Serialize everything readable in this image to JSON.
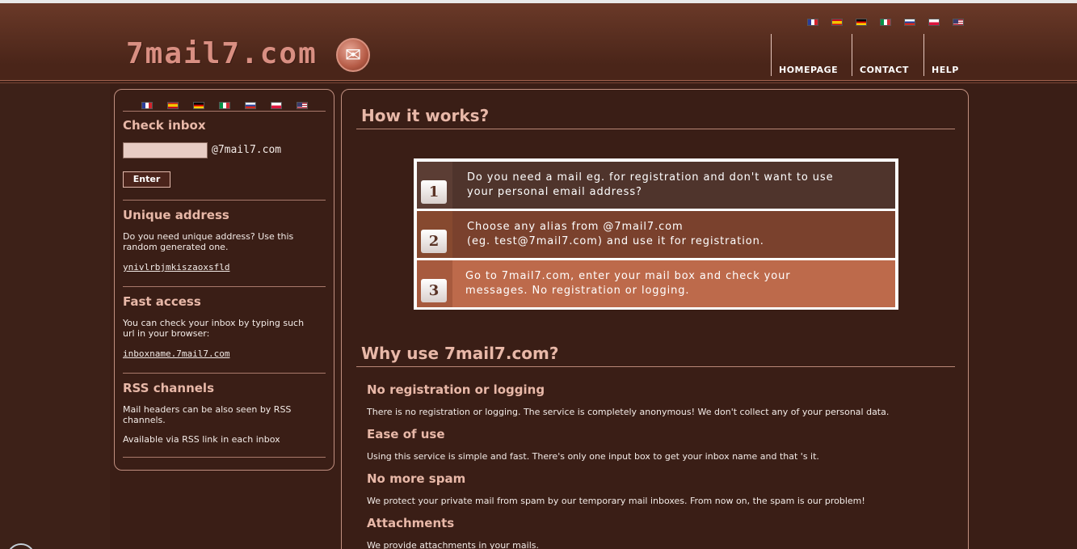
{
  "site": {
    "logo_text": "7mail7.com",
    "logo_icon": "envelope-icon"
  },
  "languages": [
    "fr",
    "es",
    "de",
    "it",
    "ru",
    "pl",
    "us"
  ],
  "nav": {
    "homepage": "HOMEPAGE",
    "contact": "CONTACT",
    "help": "HELP"
  },
  "sidebar": {
    "check_inbox": {
      "heading": "Check inbox",
      "input_value": "",
      "domain": "@7mail7.com",
      "button": "Enter"
    },
    "unique_address": {
      "heading": "Unique address",
      "text": "Do you need unique address? Use this random generated one.",
      "link": "ynivlrbjmkiszaoxsfld"
    },
    "fast_access": {
      "heading": "Fast access",
      "text": "You can check your inbox by typing such url in your browser:",
      "link": "inboxname.7mail7.com"
    },
    "rss": {
      "heading": "RSS channels",
      "text1": "Mail headers can be also seen by RSS channels.",
      "text2": "Available via RSS link in each inbox"
    }
  },
  "main": {
    "how_heading": "How it works?",
    "steps": [
      {
        "num": "1",
        "line1": "Do you need a mail eg. for registration and don't want to use",
        "line2": "your personal email address?"
      },
      {
        "num": "2",
        "line1": "Choose any alias from @7mail7.com",
        "line2": "(eg. test@7mail7.com) and use it for registration."
      },
      {
        "num": "3",
        "line1": "Go to 7mail7.com, enter your mail box and check your",
        "line2": "messages. No registration or logging."
      }
    ],
    "why_heading": "Why use 7mail7.com?",
    "features": [
      {
        "title": "No registration or logging",
        "text": "There is no registration or logging. The service is completely anonymous! We don't collect any of your personal data."
      },
      {
        "title": "Ease of use",
        "text": "Using this service is simple and fast. There's only one input box to get your inbox name and that 's it."
      },
      {
        "title": "No more spam",
        "text": "We protect your private mail from spam by our temporary mail inboxes. From now on, the spam is our problem!"
      },
      {
        "title": "Attachments",
        "text": "We provide attachments in your mails."
      }
    ]
  },
  "colors": {
    "background": "#3a1e16",
    "heading": "#e8b8a8",
    "step1": "#4f342c",
    "step2": "#7a412d",
    "step3": "#bd6a4b"
  }
}
